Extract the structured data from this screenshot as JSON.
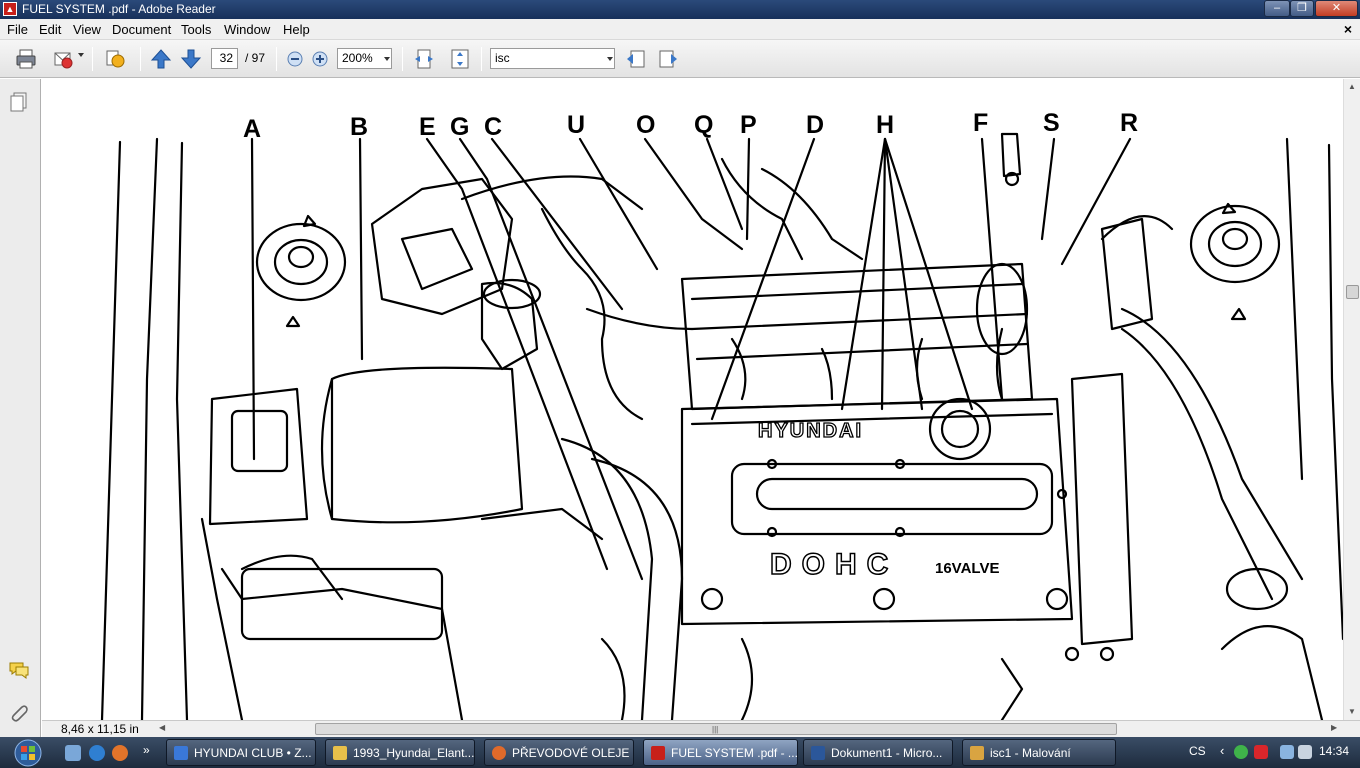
{
  "window": {
    "title": "FUEL SYSTEM .pdf - Adobe Reader"
  },
  "menu": {
    "items": [
      "File",
      "Edit",
      "View",
      "Document",
      "Tools",
      "Window",
      "Help"
    ],
    "doc_close": "×"
  },
  "toolbar": {
    "page_current": "32",
    "page_total": "/ 97",
    "zoom": "200%",
    "search": "isc"
  },
  "icons": {
    "print": "printer-icon",
    "email": "email-icon",
    "page_up": "arrow-up-icon",
    "page_down": "arrow-down-icon",
    "zoom_out": "zoom-out-icon",
    "zoom_in": "zoom-in-icon",
    "fit_width": "fit-width-icon",
    "fit_page": "fit-page-icon",
    "find_prev": "find-previous-icon",
    "find_next": "find-next-icon",
    "pages": "pages-icon",
    "comments": "comments-icon",
    "attachments": "paperclip-icon"
  },
  "document": {
    "page_size": "8,46 x 11,15 in",
    "labels": [
      "A",
      "B",
      "E",
      "G",
      "C",
      "U",
      "O",
      "Q",
      "P",
      "D",
      "H",
      "F",
      "S",
      "R"
    ],
    "engine_text": {
      "brand": "HYUNDAI",
      "engine": "DOHC",
      "valve": "16VALVE"
    }
  },
  "taskbar": {
    "tasks": [
      {
        "label": "HYUNDAI CLUB • Z...",
        "color": "#3a78d8"
      },
      {
        "label": "1993_Hyundai_Elant...",
        "color": "#e8c04a"
      },
      {
        "label": "PŘEVODOVÉ OLEJE ...",
        "color": "#e06a2a"
      },
      {
        "label": "FUEL SYSTEM .pdf - ...",
        "color": "#c8201a"
      },
      {
        "label": "Dokument1 - Micro...",
        "color": "#2b579a"
      },
      {
        "label": "isc1 - Malování",
        "color": "#d9a441"
      }
    ],
    "language": "CS",
    "clock": "14:34"
  },
  "colors": {
    "titlebar": "#17305a",
    "toolbar": "#e9e9e9",
    "taskbar": "#1d2b3d",
    "adobe_red": "#c8201a"
  }
}
